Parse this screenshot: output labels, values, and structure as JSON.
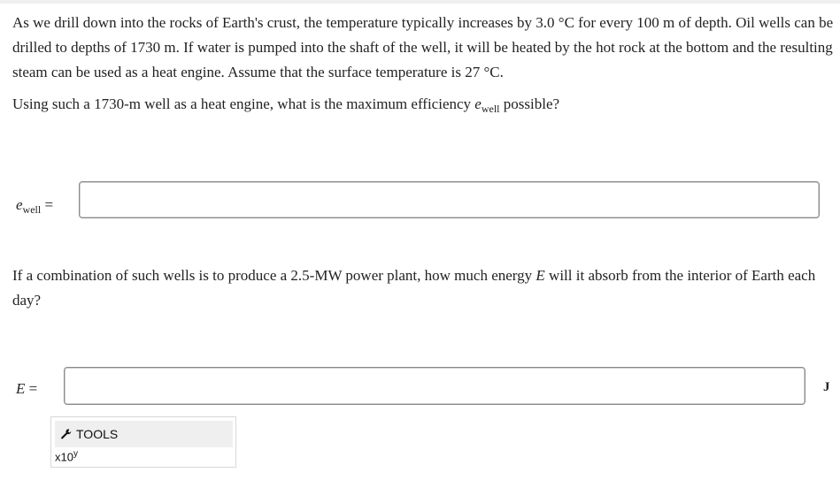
{
  "problem": {
    "intro": "As we drill down into the rocks of Earth's crust, the temperature typically increases by 3.0 °C for every 100 m of depth. Oil wells can be drilled to depths of 1730 m. If water is pumped into the shaft of the well, it will be heated by the hot rock at the bottom and the resulting steam can be used as a heat engine. Assume that the surface temperature is 27 °C.",
    "question1_pre": "Using such a 1730-m well as a heat engine, what is the maximum efficiency ",
    "question1_var": "e",
    "question1_sub": "well",
    "question1_post": " possible?",
    "question2_pre": "If a combination of such wells is to produce a 2.5-MW power plant, how much energy ",
    "question2_var": "E",
    "question2_post": " will it absorb from the interior of Earth each day?"
  },
  "answers": {
    "efficiency_label_var": "e",
    "efficiency_label_sub": "well",
    "efficiency_label_eq": " =",
    "efficiency_value": "",
    "energy_label_var": "E",
    "energy_label_eq": " =",
    "energy_value": "",
    "energy_unit": "J"
  },
  "tools": {
    "label": "TOOLS",
    "sci_base": "x10",
    "sci_exp": "y"
  }
}
